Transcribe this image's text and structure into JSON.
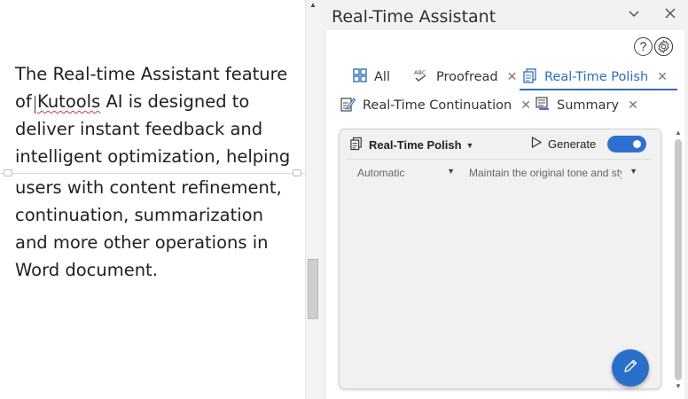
{
  "document": {
    "lines": [
      "The Real-time Assistant feature",
      "of Kutools AI is designed to",
      "deliver instant feedback and",
      "intelligent optimization, helping",
      "users with content refinement,",
      "continuation, summarization",
      "and more other operations in",
      "Word document."
    ],
    "line2_prefix": "of ",
    "line2_word": "Kutools",
    "line2_suffix": " AI is designed to"
  },
  "panel": {
    "title": "Real-Time Assistant",
    "help_label": "?",
    "tabs": [
      {
        "label": "All",
        "icon": "grid-icon",
        "closable": false,
        "active": false
      },
      {
        "label": "Proofread",
        "icon": "abc-check-icon",
        "closable": true,
        "active": false
      },
      {
        "label": "Real-Time Polish",
        "icon": "document-polish-icon",
        "closable": true,
        "active": true
      },
      {
        "label": "Real-Time Continuation",
        "icon": "edit-document-icon",
        "closable": true,
        "active": false
      },
      {
        "label": "Summary",
        "icon": "summary-icon",
        "closable": true,
        "active": false
      }
    ],
    "card": {
      "mode": "Real-Time Polish",
      "generate_label": "Generate",
      "generate_on": true,
      "select_1": "Automatic",
      "select_2": "Maintain the original tone and style"
    }
  },
  "colors": {
    "accent": "#2f6fb8",
    "toggle": "#2f6fd0",
    "fab": "#2a6fc9"
  }
}
